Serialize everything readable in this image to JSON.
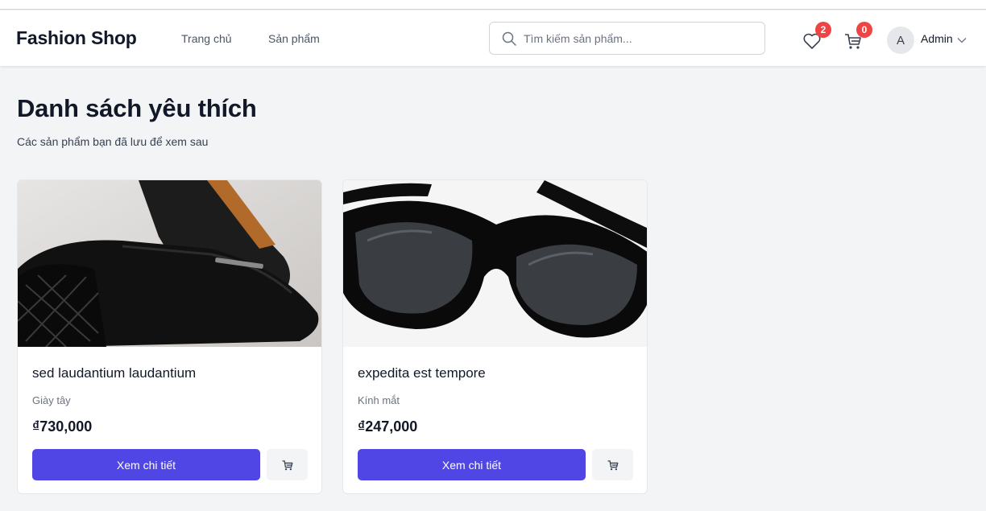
{
  "header": {
    "brand": "Fashion Shop",
    "nav": [
      {
        "label": "Trang chủ"
      },
      {
        "label": "Sản phẩm"
      }
    ],
    "search": {
      "placeholder": "Tìm kiếm sản phẩm..."
    },
    "wishlist_count": "2",
    "cart_count": "0",
    "user": {
      "initial": "A",
      "name": "Admin"
    }
  },
  "page": {
    "title": "Danh sách yêu thích",
    "subtitle": "Các sản phẩm bạn đã lưu để xem sau"
  },
  "products": [
    {
      "name": "sed laudantium laudantium",
      "category": "Giày tây",
      "price": "₫730,000",
      "detail_label": "Xem chi tiết"
    },
    {
      "name": "expedita est tempore",
      "category": "Kính mắt",
      "price": "₫247,000",
      "detail_label": "Xem chi tiết"
    }
  ],
  "colors": {
    "primary": "#4f46e5",
    "badge": "#ef4444",
    "background": "#f3f4f6"
  },
  "icons": {
    "search": "search-icon",
    "wishlist": "heart-icon",
    "cart": "cart-icon",
    "caret": "chevron-down-icon"
  }
}
